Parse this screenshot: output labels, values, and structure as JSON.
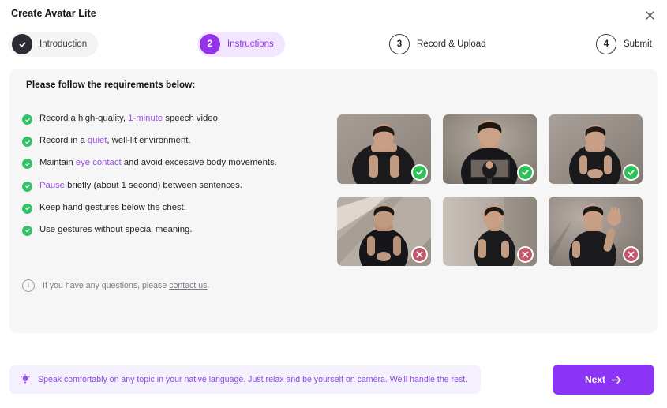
{
  "window": {
    "title": "Create Avatar Lite",
    "close_icon": "close-icon"
  },
  "stepper": {
    "steps": [
      {
        "num": "✓",
        "label": "Introduction",
        "state": "done"
      },
      {
        "num": "2",
        "label": "Instructions",
        "state": "active"
      },
      {
        "num": "3",
        "label": "Record & Upload",
        "state": "todo"
      },
      {
        "num": "4",
        "label": "Submit",
        "state": "todo"
      }
    ]
  },
  "panel": {
    "heading": "Please follow the requirements below:",
    "requirements": [
      {
        "pre": "Record a high-quality, ",
        "hl": "1-minute",
        "post": " speech video."
      },
      {
        "pre": "Record in a ",
        "hl": "quiet",
        "post": ", well-lit environment."
      },
      {
        "pre": "Maintain ",
        "hl": "eye contact",
        "post": " and avoid excessive body movements."
      },
      {
        "pre": "",
        "hl": "Pause",
        "post": " briefly (about 1 second) between sentences."
      },
      {
        "pre": "Keep hand gestures below the chest.",
        "hl": "",
        "post": ""
      },
      {
        "pre": "Use gestures without special meaning.",
        "hl": "",
        "post": ""
      }
    ],
    "note": {
      "icon": "info-icon",
      "text": "If you have any questions, please ",
      "link": "contact us",
      "suffix": "."
    },
    "examples": [
      {
        "id": "front-facing-good",
        "status": "ok",
        "badge_icon": "check-icon"
      },
      {
        "id": "phone-framing-good",
        "status": "ok",
        "badge_icon": "check-icon"
      },
      {
        "id": "hands-clasped-good",
        "status": "ok",
        "badge_icon": "check-icon"
      },
      {
        "id": "harsh-shadows-bad",
        "status": "no",
        "badge_icon": "cross-icon"
      },
      {
        "id": "side-profile-bad",
        "status": "no",
        "badge_icon": "cross-icon"
      },
      {
        "id": "raised-gesture-bad",
        "status": "no",
        "badge_icon": "cross-icon"
      }
    ]
  },
  "footer": {
    "tip_icon": "lightbulb-icon",
    "tip": "Speak comfortably on any topic in your native language. Just relax and be yourself on camera. We'll handle the rest.",
    "next_label": "Next",
    "next_icon": "arrow-right-icon"
  },
  "colors": {
    "accent": "#8b34f5",
    "accent_soft": "#f1e6fe",
    "active_text": "#9333ea",
    "panel_bg": "#f6f6f7",
    "ok": "#2fc25b",
    "no": "#c4566e",
    "dark": "#2b2b33"
  }
}
